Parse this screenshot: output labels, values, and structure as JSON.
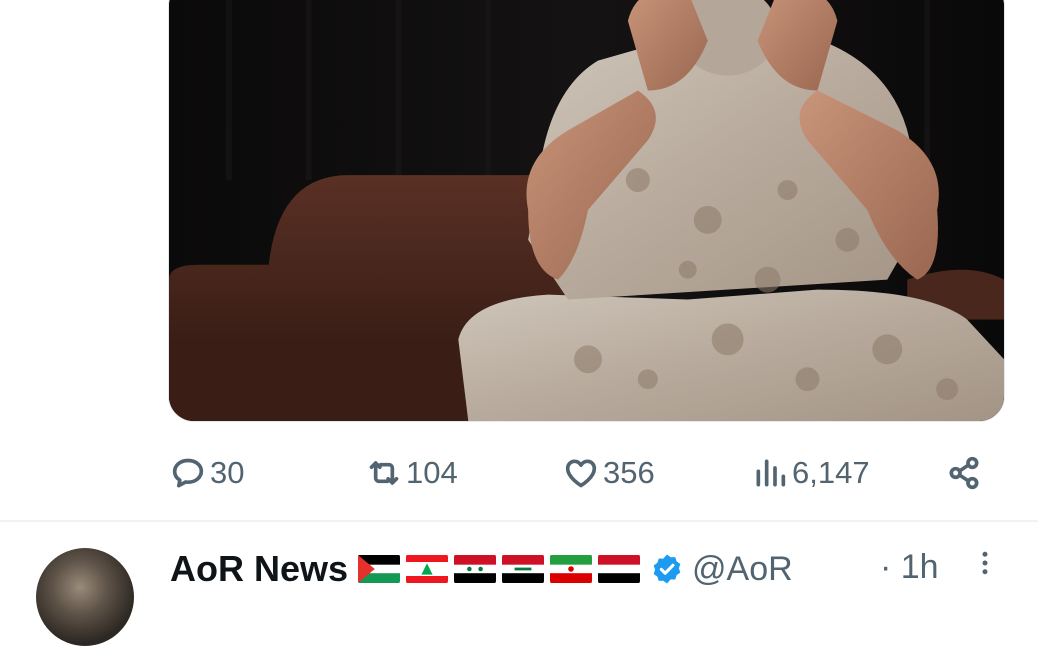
{
  "tweet": {
    "media": {
      "description_icon": "photo"
    },
    "actions": {
      "reply": {
        "icon": "speech-bubble-icon",
        "count": "30"
      },
      "retweet": {
        "icon": "retweet-arrows-icon",
        "count": "104"
      },
      "like": {
        "icon": "heart-icon",
        "count": "356"
      },
      "views": {
        "icon": "bar-chart-icon",
        "count": "6,147"
      },
      "share": {
        "icon": "share-nodes-icon"
      }
    }
  },
  "next_tweet": {
    "author_name": "AoR News",
    "flags": [
      "palestine-flag",
      "lebanon-flag",
      "syria-flag",
      "iraq-flag",
      "iran-flag",
      "yemen-flag"
    ],
    "verified": true,
    "handle": "@AoR",
    "time": "· 1h"
  },
  "colors": {
    "text_primary": "#0f1419",
    "text_secondary": "#536471",
    "divider": "#eff3f4",
    "verified_blue": "#1d9bf0"
  }
}
